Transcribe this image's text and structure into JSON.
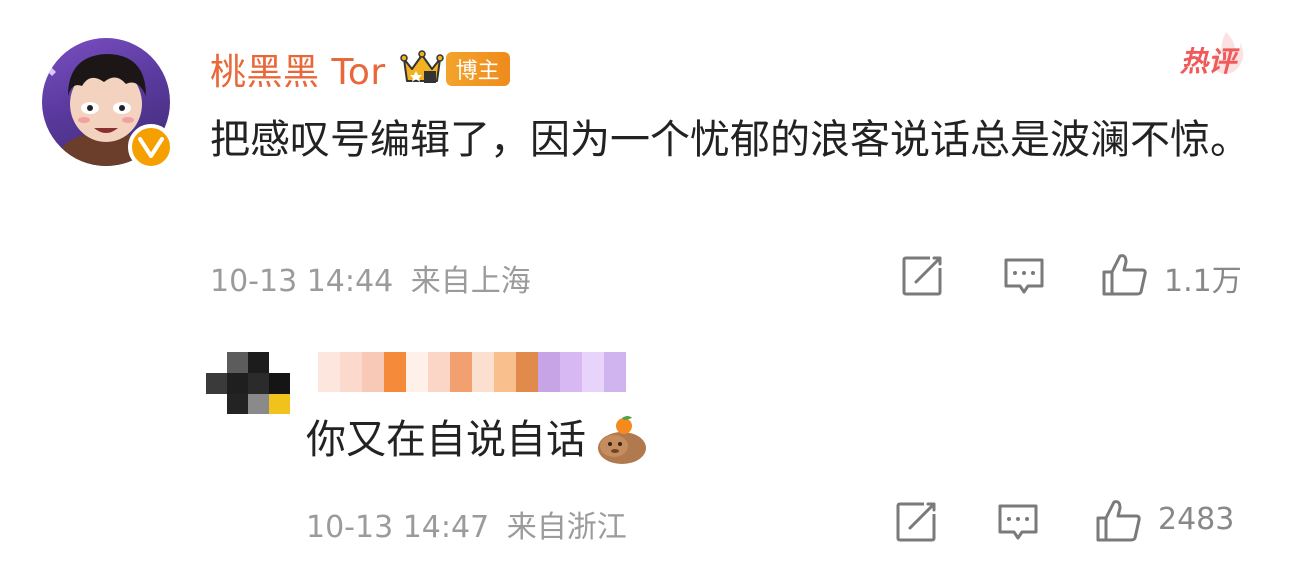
{
  "main_comment": {
    "username": "桃黑黑 Tor",
    "role_badge": "博主",
    "hot_tag": "热评",
    "text": "把感叹号编辑了，因为一个忧郁的浪客说话总是波澜不惊。",
    "time": "10-13 14:44",
    "location": "来自上海",
    "like_count": "1.1万",
    "icons": [
      "crown-icon",
      "verified-icon",
      "share-icon",
      "comment-icon",
      "like-icon"
    ]
  },
  "reply": {
    "text": "你又在自说自话",
    "time": "10-13 14:47",
    "location": "来自浙江",
    "like_count": "2483",
    "icons": [
      "capybara-emoji-icon",
      "share-icon",
      "comment-icon",
      "like-icon"
    ]
  },
  "colors": {
    "username": "#e8683a",
    "badge": "#f4a32c",
    "hot": "#f05a5a",
    "meta": "#9b9b9b"
  }
}
